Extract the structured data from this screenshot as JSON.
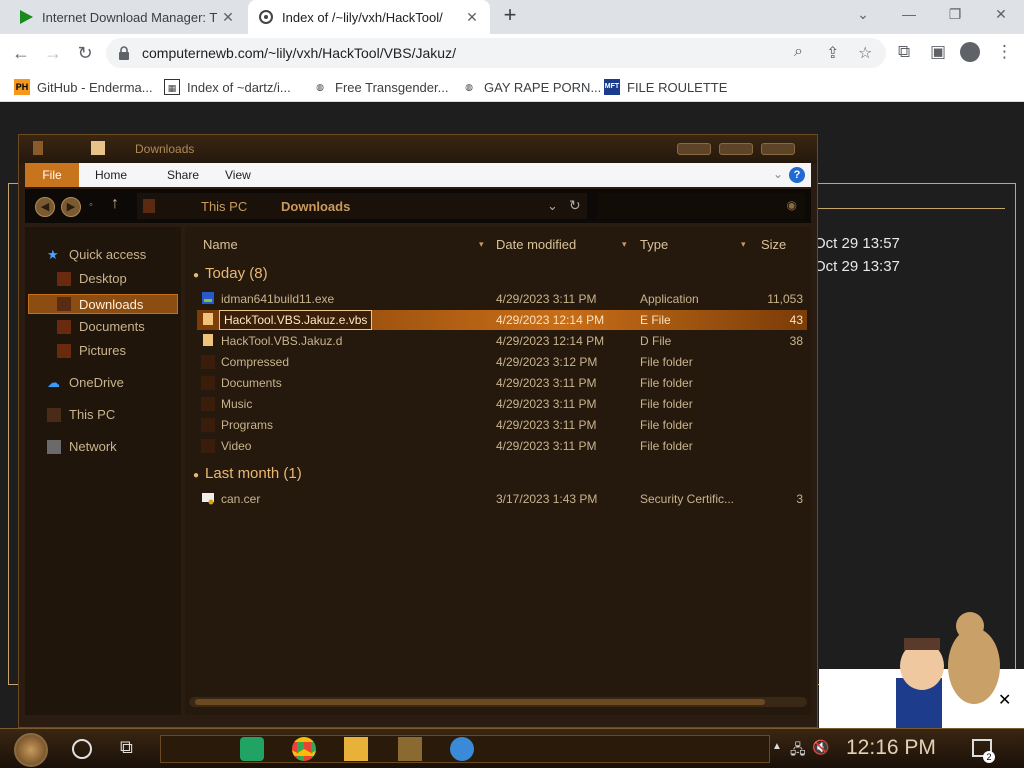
{
  "browser": {
    "tabs": [
      {
        "title": "Internet Download Manager: T",
        "active": false
      },
      {
        "title": "Index of /~lily/vxh/HackTool/",
        "active": true
      }
    ],
    "new_tab": "+",
    "url": "computernewb.com/~lily/vxh/HackTool/VBS/Jakuz/",
    "bookmarks": [
      {
        "label": "GitHub - Enderma...",
        "icon": "PH"
      },
      {
        "label": "Index of ~dartz/i...",
        "icon": "grid-icon"
      },
      {
        "label": "Free Transgender...",
        "icon": "globe-icon"
      },
      {
        "label": "GAY RAPE PORN...",
        "icon": "globe-icon"
      },
      {
        "label": "FILE ROULETTE",
        "icon": "MFT"
      }
    ]
  },
  "page": {
    "dates": [
      "Oct 29 13:57",
      "Oct 29 13:37"
    ]
  },
  "explorer": {
    "title": "Downloads",
    "ribbon": {
      "file": "File",
      "home": "Home",
      "share": "Share",
      "view": "View",
      "help": "?"
    },
    "breadcrumb": [
      "This PC",
      "Downloads"
    ],
    "nav": {
      "quick_access": "Quick access",
      "desktop": "Desktop",
      "downloads": "Downloads",
      "documents": "Documents",
      "pictures": "Pictures",
      "onedrive": "OneDrive",
      "this_pc": "This PC",
      "network": "Network"
    },
    "columns": {
      "name": "Name",
      "date": "Date modified",
      "type": "Type",
      "size": "Size"
    },
    "groups": [
      {
        "label": "Today (8)",
        "rows": [
          {
            "name": "idman641build11.exe",
            "date": "4/29/2023 3:11 PM",
            "type": "Application",
            "size": "11,053",
            "icon": "app"
          },
          {
            "name": "HackTool.VBS.Jakuz.e.vbs",
            "date": "4/29/2023 12:14 PM",
            "type": "E File",
            "size": "43",
            "icon": "file",
            "selected": true
          },
          {
            "name": "HackTool.VBS.Jakuz.d",
            "date": "4/29/2023 12:14 PM",
            "type": "D File",
            "size": "38",
            "icon": "file"
          },
          {
            "name": "Compressed",
            "date": "4/29/2023 3:12 PM",
            "type": "File folder",
            "size": "",
            "icon": "folder"
          },
          {
            "name": "Documents",
            "date": "4/29/2023 3:11 PM",
            "type": "File folder",
            "size": "",
            "icon": "folder"
          },
          {
            "name": "Music",
            "date": "4/29/2023 3:11 PM",
            "type": "File folder",
            "size": "",
            "icon": "folder"
          },
          {
            "name": "Programs",
            "date": "4/29/2023 3:11 PM",
            "type": "File folder",
            "size": "",
            "icon": "folder"
          },
          {
            "name": "Video",
            "date": "4/29/2023 3:11 PM",
            "type": "File folder",
            "size": "",
            "icon": "folder"
          }
        ]
      },
      {
        "label": "Last month (1)",
        "rows": [
          {
            "name": "can.cer",
            "date": "3/17/2023 1:43 PM",
            "type": "Security Certific...",
            "size": "3",
            "icon": "cert"
          }
        ]
      }
    ]
  },
  "taskbar": {
    "time": "12:16 PM",
    "notifications": "2"
  }
}
